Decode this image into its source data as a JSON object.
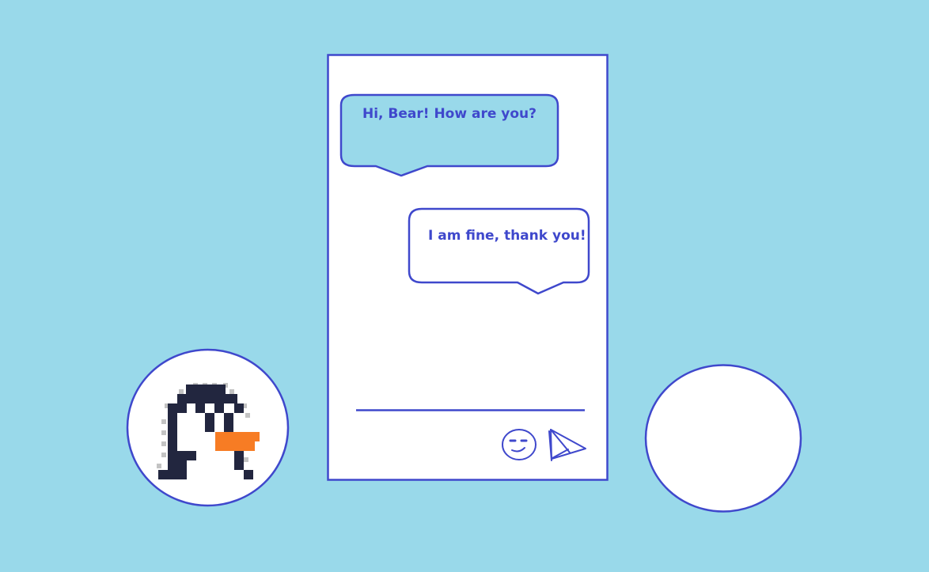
{
  "colors": {
    "background": "#99d9ea",
    "accent": "#3f48cc",
    "panel": "#ffffff",
    "bubble_fill": "#99d9ea",
    "penguin_body": "#22263f",
    "penguin_beak": "#f77c24",
    "penguin_outline": "#c3c3c3"
  },
  "messages": [
    {
      "sender": "left",
      "text": "Hi, Bear! How are you?"
    },
    {
      "sender": "right",
      "text": "I am fine, thank you!"
    }
  ],
  "composer": {
    "input_value": "",
    "emoji_icon": "smiley-face-icon",
    "send_icon": "paper-plane-icon"
  },
  "avatars": {
    "left_icon": "penguin-icon",
    "right_icon": "empty-avatar"
  }
}
